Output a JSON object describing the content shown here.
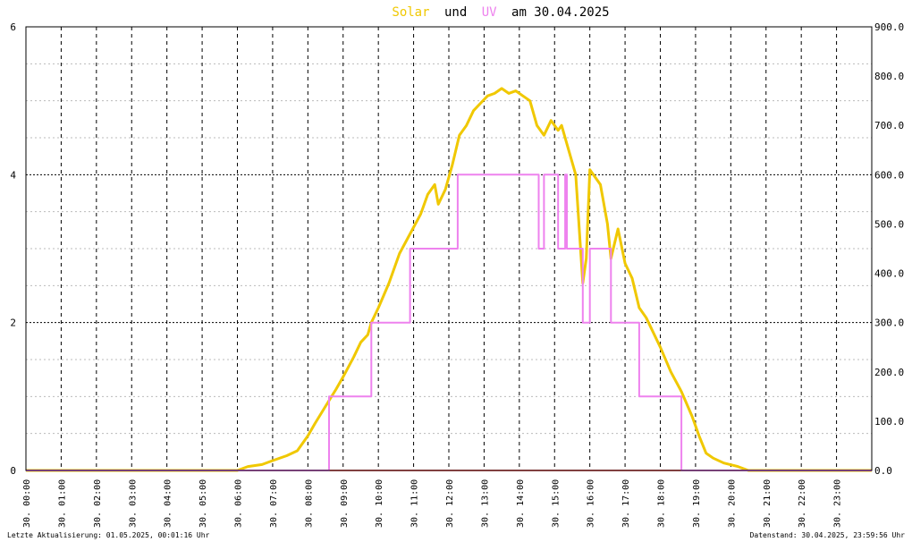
{
  "chart_data": {
    "type": "line",
    "title_parts": {
      "solar": "Solar",
      "und": "und",
      "uv": "UV",
      "am_date": "am 30.04.2025"
    },
    "colors": {
      "solar": "#f0c800",
      "uv": "#ee82ee",
      "title_text": "#000000",
      "grid": "#000000",
      "zero_line": "#ff8080"
    },
    "grid": true,
    "x_ticks": [
      "30. 00:00",
      "30. 01:00",
      "30. 02:00",
      "30. 03:00",
      "30. 04:00",
      "30. 05:00",
      "30. 06:00",
      "30. 07:00",
      "30. 08:00",
      "30. 09:00",
      "30. 10:00",
      "30. 11:00",
      "30. 12:00",
      "30. 13:00",
      "30. 14:00",
      "30. 15:00",
      "30. 16:00",
      "30. 17:00",
      "30. 18:00",
      "30. 19:00",
      "30. 20:00",
      "30. 21:00",
      "30. 22:00",
      "30. 23:00"
    ],
    "y_left_ticks": [
      "0",
      "2",
      "4",
      "6"
    ],
    "y_left_range": [
      0,
      6
    ],
    "y_right_ticks": [
      "0.0",
      "100.0",
      "200.0",
      "300.0",
      "400.0",
      "500.0",
      "600.0",
      "700.0",
      "800.0",
      "900.0"
    ],
    "y_right_range": [
      0,
      900
    ],
    "series": [
      {
        "name": "Solar",
        "axis": "right",
        "points": [
          [
            0,
            0
          ],
          [
            6.0,
            0
          ],
          [
            6.3,
            8
          ],
          [
            6.7,
            12
          ],
          [
            7.0,
            20
          ],
          [
            7.4,
            30
          ],
          [
            7.7,
            40
          ],
          [
            8.0,
            70
          ],
          [
            8.2,
            95
          ],
          [
            8.5,
            130
          ],
          [
            8.8,
            165
          ],
          [
            9.0,
            190
          ],
          [
            9.3,
            230
          ],
          [
            9.5,
            260
          ],
          [
            9.7,
            275
          ],
          [
            9.8,
            300
          ],
          [
            10.0,
            330
          ],
          [
            10.3,
            380
          ],
          [
            10.6,
            440
          ],
          [
            10.9,
            480
          ],
          [
            11.2,
            520
          ],
          [
            11.4,
            560
          ],
          [
            11.6,
            580
          ],
          [
            11.7,
            540
          ],
          [
            11.9,
            570
          ],
          [
            12.1,
            620
          ],
          [
            12.3,
            680
          ],
          [
            12.5,
            700
          ],
          [
            12.7,
            730
          ],
          [
            12.9,
            745
          ],
          [
            13.1,
            760
          ],
          [
            13.3,
            765
          ],
          [
            13.5,
            775
          ],
          [
            13.7,
            765
          ],
          [
            13.9,
            770
          ],
          [
            14.1,
            760
          ],
          [
            14.3,
            750
          ],
          [
            14.5,
            700
          ],
          [
            14.7,
            680
          ],
          [
            14.9,
            710
          ],
          [
            15.1,
            690
          ],
          [
            15.2,
            700
          ],
          [
            15.4,
            650
          ],
          [
            15.6,
            600
          ],
          [
            15.8,
            380
          ],
          [
            15.9,
            430
          ],
          [
            16.0,
            610
          ],
          [
            16.1,
            600
          ],
          [
            16.3,
            580
          ],
          [
            16.5,
            500
          ],
          [
            16.6,
            430
          ],
          [
            16.8,
            490
          ],
          [
            17.0,
            420
          ],
          [
            17.2,
            390
          ],
          [
            17.4,
            330
          ],
          [
            17.6,
            310
          ],
          [
            17.8,
            280
          ],
          [
            18.0,
            250
          ],
          [
            18.3,
            200
          ],
          [
            18.6,
            160
          ],
          [
            18.9,
            110
          ],
          [
            19.1,
            70
          ],
          [
            19.3,
            35
          ],
          [
            19.5,
            25
          ],
          [
            19.8,
            15
          ],
          [
            20.2,
            8
          ],
          [
            20.5,
            0
          ],
          [
            24,
            0
          ]
        ]
      },
      {
        "name": "UV",
        "axis": "left",
        "points": [
          [
            0,
            0
          ],
          [
            8.6,
            0
          ],
          [
            8.6,
            1
          ],
          [
            9.8,
            1
          ],
          [
            9.8,
            2
          ],
          [
            10.9,
            2
          ],
          [
            10.9,
            3
          ],
          [
            12.25,
            3
          ],
          [
            12.25,
            4
          ],
          [
            14.55,
            4
          ],
          [
            14.55,
            3
          ],
          [
            14.7,
            3
          ],
          [
            14.7,
            4
          ],
          [
            15.1,
            4
          ],
          [
            15.1,
            3
          ],
          [
            15.3,
            3
          ],
          [
            15.3,
            4
          ],
          [
            15.35,
            4
          ],
          [
            15.35,
            3
          ],
          [
            15.8,
            3
          ],
          [
            15.8,
            2
          ],
          [
            16.0,
            2
          ],
          [
            16.0,
            3
          ],
          [
            16.6,
            3
          ],
          [
            16.6,
            2
          ],
          [
            17.4,
            2
          ],
          [
            17.4,
            1
          ],
          [
            18.6,
            1
          ],
          [
            18.6,
            0
          ],
          [
            24,
            0
          ]
        ]
      }
    ]
  },
  "footer": {
    "left": "Letzte Aktualisierung: 01.05.2025, 00:01:16 Uhr",
    "right": "Datenstand: 30.04.2025, 23:59:56 Uhr"
  }
}
